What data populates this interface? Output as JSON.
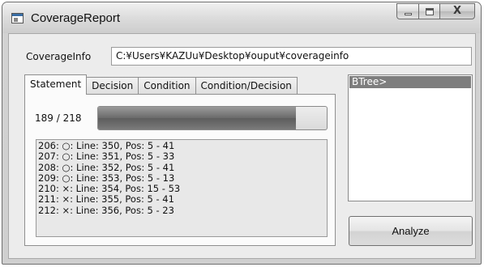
{
  "window": {
    "title": "CoverageReport",
    "close_glyph": "X"
  },
  "coverage_info": {
    "label": "CoverageInfo",
    "value": "C:¥Users¥KAZUu¥Desktop¥ouput¥coverageinfo"
  },
  "tabs": [
    {
      "label": "Statement",
      "active": true
    },
    {
      "label": "Decision",
      "active": false
    },
    {
      "label": "Condition",
      "active": false
    },
    {
      "label": "Condition/Decision",
      "active": false
    }
  ],
  "progress": {
    "label": "189 / 218",
    "covered": 189,
    "total": 218
  },
  "statements": [
    "206: ○: Line: 350, Pos: 5 - 41",
    "207: ○: Line: 351, Pos: 5 - 33",
    "208: ○: Line: 352, Pos: 5 - 41",
    "209: ○: Line: 353, Pos: 5 - 13",
    "210: ×: Line: 354, Pos: 15 - 53",
    "211: ×: Line: 355, Pos: 5 - 41",
    "212: ×: Line: 356, Pos: 5 - 23"
  ],
  "tree": {
    "items": [
      "BTree>"
    ]
  },
  "analyze_button": {
    "label": "Analyze"
  },
  "icons": {
    "app": "app-window-icon",
    "minimize": "minimize-icon",
    "maximize": "maximize-icon",
    "close": "close-icon"
  }
}
